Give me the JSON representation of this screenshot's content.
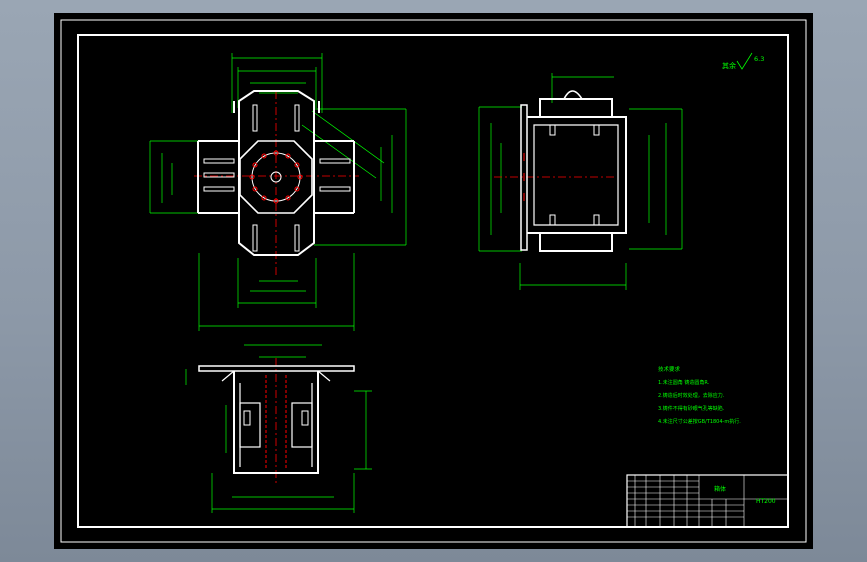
{
  "drawing": {
    "roughness_symbol": "其余",
    "roughness_value": "6.3",
    "tech_requirements": {
      "title": "技术要求",
      "items": [
        "1.未注圆角 铸造圆角R.",
        "2.铸造后时效处理，去除应力.",
        "3.铸件不得有砂眼气孔等缺陷.",
        "4.未注尺寸公差按GB/T1804-m执行."
      ]
    },
    "title_block": {
      "part_name": "箱体",
      "material": "HT200"
    }
  },
  "colors": {
    "background": "#000000",
    "outline": "#ffffff",
    "dimension": "#00ff00",
    "centerline": "#ff0000",
    "frame_bg": "#8d99a8"
  }
}
